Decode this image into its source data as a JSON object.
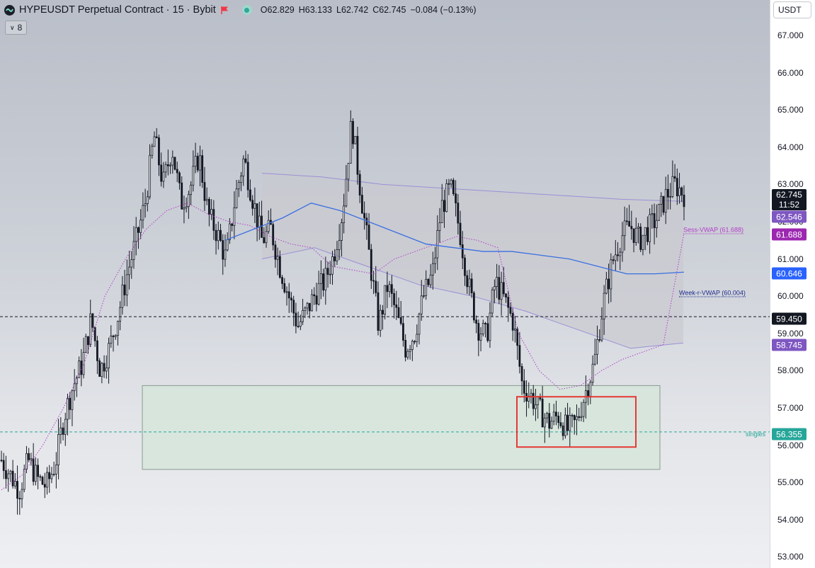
{
  "header": {
    "title": "HYPEUSDT Perpetual Contract · 15 · Bybit",
    "ohlc": {
      "open": "O62.829",
      "high": "H63.133",
      "low": "L62.742",
      "close": "C62.745",
      "change": "−0.084 (−0.13%)"
    },
    "collapse_count": "8"
  },
  "axis": {
    "currency": "USDT",
    "ticks": [
      "67.000",
      "66.000",
      "65.000",
      "64.000",
      "63.000",
      "62.000",
      "61.000",
      "60.000",
      "59.000",
      "58.000",
      "57.000",
      "56.000",
      "55.000",
      "54.000",
      "53.000"
    ]
  },
  "price_tags": {
    "last": "62.745",
    "countdown": "11:52",
    "upper_band": "62.546",
    "sess_vwap": "61.688",
    "week_vwap": "60.646",
    "hline": "59.450",
    "lower_band": "58.745",
    "singles": "56.355"
  },
  "labels": {
    "sess_vwap": "Sess-VWAP (61.688)",
    "week_vwap": "Week-r-VWAP (60.004)",
    "singles": "singles"
  },
  "colors": {
    "candle": "#131722",
    "sess_vwap": "#b13fc7",
    "week_vwap": "#3b6fe0",
    "band": "#9a8fd6",
    "purple_tag": "#7e57c2",
    "blue_tag": "#2962ff",
    "hline": "#131722",
    "singles": "#26a69a",
    "red_box": "#e53935"
  },
  "chart_data": {
    "type": "line",
    "title": "HYPEUSDT Perpetual Contract · 15 · Bybit",
    "ylim": [
      53,
      67.5
    ],
    "y_ticks": [
      53,
      54,
      55,
      56,
      57,
      58,
      59,
      60,
      61,
      62,
      63,
      64,
      65,
      66,
      67
    ],
    "close_path": [
      55.6,
      55.2,
      54.8,
      55.6,
      55.1,
      54.9,
      55.5,
      56.8,
      57.6,
      58.2,
      59.4,
      58.0,
      58.6,
      59.5,
      60.6,
      61.5,
      62.5,
      64.3,
      63.0,
      64.0,
      62.5,
      62.9,
      63.8,
      62.2,
      61.7,
      61.0,
      62.6,
      63.7,
      62.6,
      61.5,
      61.8,
      60.8,
      60.0,
      59.2,
      59.6,
      60.1,
      60.4,
      61.1,
      62.3,
      64.7,
      62.8,
      61.0,
      59.2,
      60.3,
      59.5,
      58.6,
      59.0,
      60.0,
      60.6,
      62.4,
      62.9,
      61.8,
      60.3,
      59.2,
      58.9,
      60.4,
      59.9,
      59.3,
      57.6,
      57.3,
      56.9,
      56.6,
      56.8,
      56.4,
      56.6,
      57.4,
      58.2,
      59.8,
      60.9,
      61.6,
      61.9,
      61.5,
      61.8,
      62.1,
      62.7,
      63.0,
      62.745
    ],
    "series": [
      {
        "name": "Sess-VWAP",
        "values": [
          54.8,
          55.2,
          56.0,
          57.0,
          58.2,
          60.0,
          61.0,
          61.8,
          62.3,
          62.5,
          62.2,
          62.0,
          61.9,
          61.6,
          61.4,
          61.3,
          60.8,
          60.7,
          60.6,
          61.0,
          61.2,
          61.4,
          61.6,
          61.5,
          61.3,
          59.0,
          58.0,
          57.5,
          57.6,
          58.0,
          58.3,
          58.5,
          58.7,
          61.688
        ]
      },
      {
        "name": "Week-r-VWAP",
        "values": [
          61.5,
          61.8,
          62.1,
          62.5,
          62.3,
          62.0,
          61.7,
          61.4,
          61.3,
          61.2,
          61.2,
          61.1,
          61.0,
          60.8,
          60.6,
          60.6,
          60.646
        ]
      }
    ],
    "upper_band": [
      63.3,
      63.2,
      63.0,
      62.9,
      62.8,
      62.7,
      62.6,
      62.546
    ],
    "lower_band": [
      61.0,
      61.3,
      60.8,
      60.3,
      60.0,
      59.6,
      59.1,
      58.6,
      58.745
    ],
    "horizontal_line": 59.45,
    "singles_level": 56.355,
    "demand_zone": {
      "price_top": 57.6,
      "price_bottom": 55.35
    },
    "highlight_box": {
      "price_top": 57.3,
      "price_bottom": 55.95
    }
  }
}
